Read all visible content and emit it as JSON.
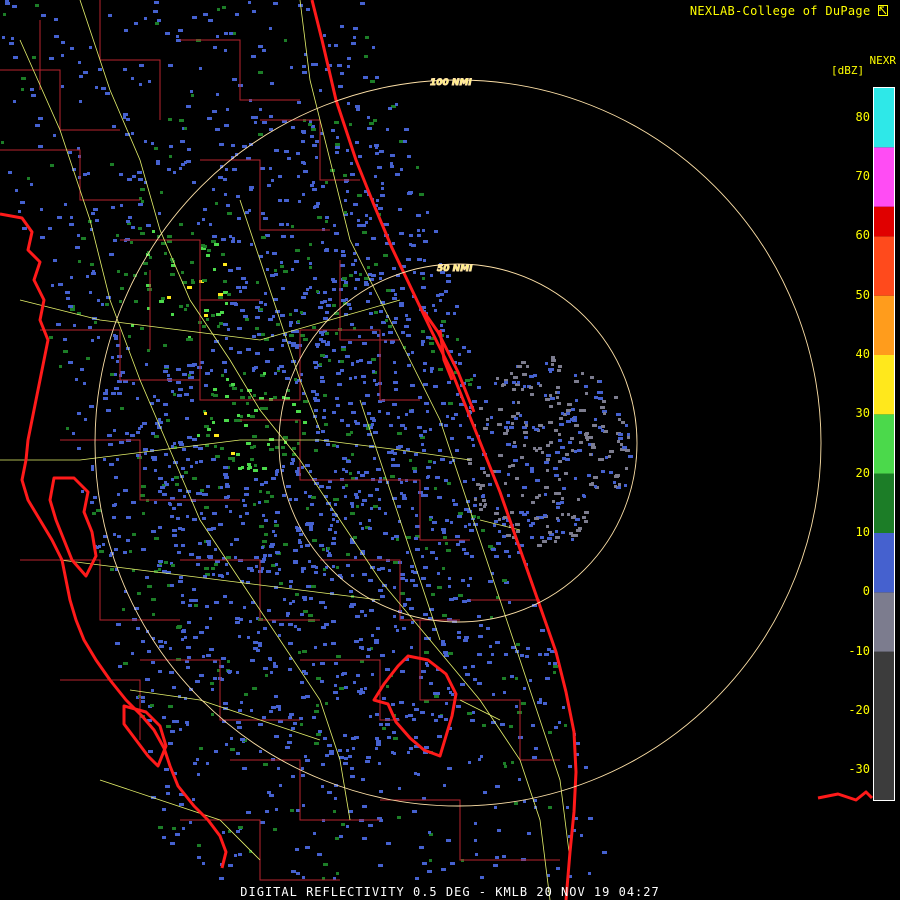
{
  "header": {
    "credit": "NEXLAB-College of DuPage",
    "credit_icon": "cursor-arrow-icon"
  },
  "legend": {
    "product": "NEXR",
    "units": "[dBZ]",
    "ticks": [
      "80",
      "70",
      "60",
      "50",
      "40",
      "30",
      "20",
      "10",
      "0",
      "-10",
      "-20",
      "-30"
    ],
    "bands": [
      {
        "from": -35,
        "to": -10,
        "color": "#3c3c3c"
      },
      {
        "from": -10,
        "to": 0,
        "color": "#7c7c8e"
      },
      {
        "from": 0,
        "to": 10,
        "color": "#4561cf"
      },
      {
        "from": 10,
        "to": 20,
        "color": "#1c7d27"
      },
      {
        "from": 20,
        "to": 30,
        "color": "#4bd94b"
      },
      {
        "from": 30,
        "to": 40,
        "color": "#ffe81c"
      },
      {
        "from": 40,
        "to": 50,
        "color": "#ff9c1c"
      },
      {
        "from": 50,
        "to": 60,
        "color": "#ff4a1c"
      },
      {
        "from": 60,
        "to": 65,
        "color": "#e00000"
      },
      {
        "from": 65,
        "to": 75,
        "color": "#ff4cf4"
      },
      {
        "from": 75,
        "to": 85,
        "color": "#2ee8e8"
      }
    ]
  },
  "map": {
    "ring_labels": [
      "100 NMI",
      "50 NMI"
    ],
    "colors": {
      "coastline": "#ff1a1a",
      "county_lines": "#b8232e",
      "roads": "#e6f26b",
      "rings": "#ffe2a8",
      "no_echo": "#000000"
    }
  },
  "footer": {
    "caption": "DIGITAL REFLECTIVITY 0.5 DEG - KMLB 20 NOV 19 04:27"
  }
}
